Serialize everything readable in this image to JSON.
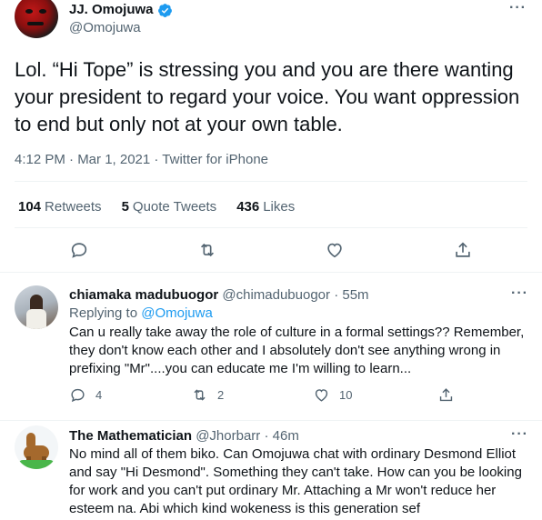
{
  "tweet": {
    "display_name": "JJ. Omojuwa",
    "handle": "@Omojuwa",
    "text": "Lol. “Hi Tope” is stressing you and you are there wanting your president to regard your voice. You want oppression to end but only not at your own table.",
    "meta": "4:12 PM · Mar 1, 2021 · Twitter for iPhone",
    "stats": {
      "retweets_count": "104",
      "retweets_label": "Retweets",
      "quotes_count": "5",
      "quotes_label": "Quote Tweets",
      "likes_count": "436",
      "likes_label": "Likes"
    }
  },
  "replies": [
    {
      "name": "chiamaka madubuogor",
      "handle": "@chimadubuogor",
      "time": "· 55m",
      "replying_prefix": "Replying to",
      "replying_handle": "@Omojuwa",
      "text": "Can u really take away the role of culture in a formal settings?? Remember, they don't know each other and I absolutely don't see anything wrong in prefixing \"Mr\"....you can educate me I'm willing  to learn...",
      "reply_count": "4",
      "retweet_count": "2",
      "like_count": "10"
    },
    {
      "name": "The Mathematician",
      "handle": "@Jhorbarr",
      "time": "· 46m",
      "text": "No mind all of them biko. Can Omojuwa chat with ordinary Desmond Elliot and say \"Hi Desmond\". Something they can't take. How can you be looking for work and you can't put ordinary Mr. Attaching a Mr won't reduce her esteem na. Abi which kind wokeness is this generation sef"
    }
  ],
  "icons": {
    "more": "more-dots-icon",
    "verified": "verified-badge-icon",
    "reply": "reply-icon",
    "retweet": "retweet-icon",
    "like": "heart-icon",
    "share": "share-icon"
  },
  "colors": {
    "accent": "#1d9bf0",
    "secondary_text": "#536471",
    "primary_text": "#0f1419",
    "divider": "#eff3f4"
  }
}
